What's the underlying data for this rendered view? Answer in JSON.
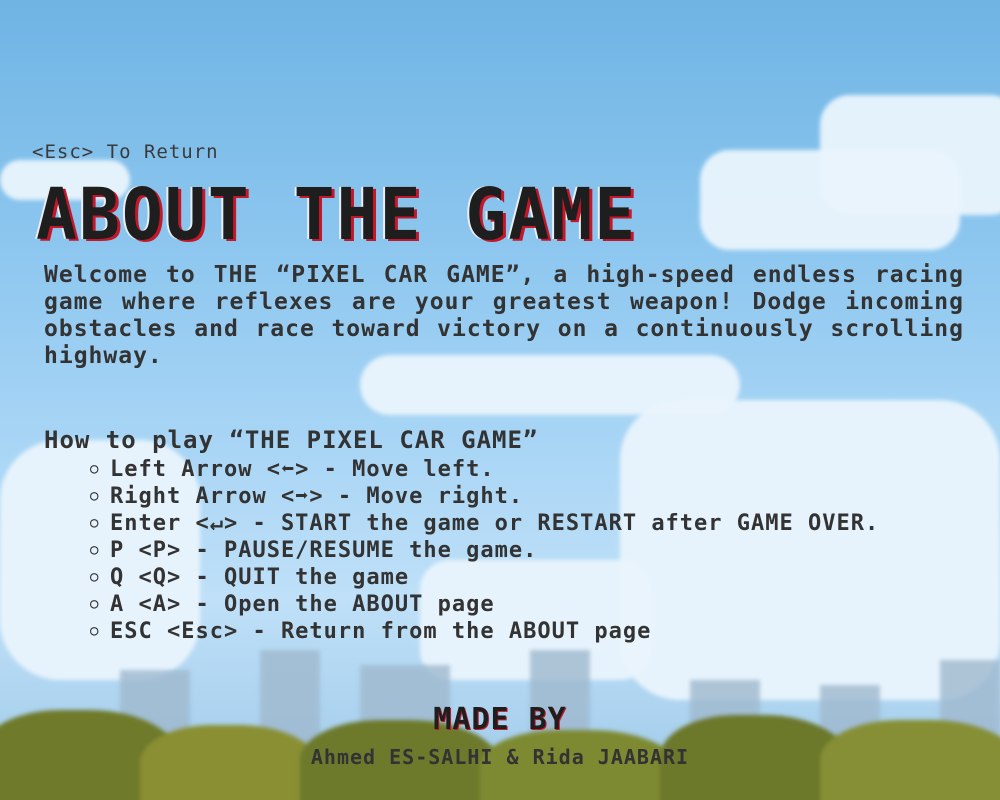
{
  "hint": {
    "esc_return": "<Esc> To Return"
  },
  "title": "ABOUT THE GAME",
  "intro": "Welcome to THE “PIXEL CAR GAME”, a high-speed endless racing game where reflexes are your greatest weapon! Dodge incoming obstacles and race toward victory on a continuously scrolling highway.",
  "howto": {
    "heading": "How to play “THE PIXEL CAR GAME”",
    "controls": [
      {
        "text": "Left Arrow <⬅> - Move left."
      },
      {
        "text": "Right Arrow <➡> - Move right."
      },
      {
        "text": "Enter <↵> - START the game or RESTART after GAME OVER."
      },
      {
        "text": "P <P> - PAUSE/RESUME the game."
      },
      {
        "text": "Q <Q> - QUIT the game"
      },
      {
        "text": "A <A> - Open the ABOUT page"
      },
      {
        "text": "ESC <Esc> - Return from the ABOUT page"
      }
    ],
    "bullet": "○"
  },
  "credits": {
    "heading": "MADE BY",
    "authors": "Ahmed ES-SALHI & Rida JAABARI"
  },
  "colors": {
    "title_text": "#1e1e1e",
    "title_shadow": "#c4182a",
    "body_text": "#333333",
    "sky": "#8cc6ef"
  }
}
